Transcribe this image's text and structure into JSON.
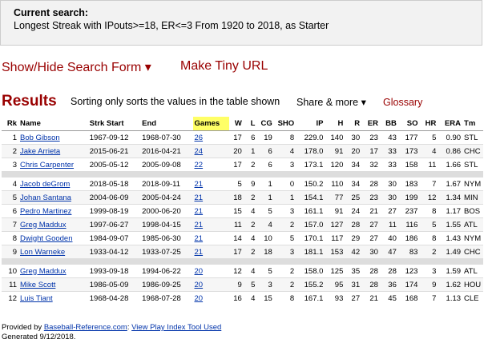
{
  "search": {
    "label": "Current search:",
    "query": "Longest Streak with IPouts>=18, ER<=3 From 1920 to 2018, as Starter"
  },
  "toggles": {
    "show_hide": "Show/Hide Search Form ▾",
    "tiny_url": "Make Tiny URL"
  },
  "results": {
    "title": "Results",
    "note": "Sorting only sorts the values in the table shown",
    "share": "Share & more ▾",
    "glossary": "Glossary"
  },
  "table": {
    "headers": [
      "Rk",
      "Name",
      "Strk Start",
      "End",
      "Games",
      "W",
      "L",
      "CG",
      "SHO",
      "IP",
      "H",
      "R",
      "ER",
      "BB",
      "SO",
      "HR",
      "ERA",
      "Tm"
    ],
    "groups": [
      [
        [
          "1",
          "Bob Gibson",
          "1967-09-12",
          "1968-07-30",
          "26",
          "17",
          "6",
          "19",
          "8",
          "229.0",
          "140",
          "30",
          "23",
          "43",
          "177",
          "5",
          "0.90",
          "STL"
        ],
        [
          "2",
          "Jake Arrieta",
          "2015-06-21",
          "2016-04-21",
          "24",
          "20",
          "1",
          "6",
          "4",
          "178.0",
          "91",
          "20",
          "17",
          "33",
          "173",
          "4",
          "0.86",
          "CHC"
        ],
        [
          "3",
          "Chris Carpenter",
          "2005-05-12",
          "2005-09-08",
          "22",
          "17",
          "2",
          "6",
          "3",
          "173.1",
          "120",
          "34",
          "32",
          "33",
          "158",
          "11",
          "1.66",
          "STL"
        ]
      ],
      [
        [
          "4",
          "Jacob deGrom",
          "2018-05-18",
          "2018-09-11",
          "21",
          "5",
          "9",
          "1",
          "0",
          "150.2",
          "110",
          "34",
          "28",
          "30",
          "183",
          "7",
          "1.67",
          "NYM"
        ],
        [
          "5",
          "Johan Santana",
          "2004-06-09",
          "2005-04-24",
          "21",
          "18",
          "2",
          "1",
          "1",
          "154.1",
          "77",
          "25",
          "23",
          "30",
          "199",
          "12",
          "1.34",
          "MIN"
        ],
        [
          "6",
          "Pedro Martinez",
          "1999-08-19",
          "2000-06-20",
          "21",
          "15",
          "4",
          "5",
          "3",
          "161.1",
          "91",
          "24",
          "21",
          "27",
          "237",
          "8",
          "1.17",
          "BOS"
        ],
        [
          "7",
          "Greg Maddux",
          "1997-06-27",
          "1998-04-15",
          "21",
          "11",
          "2",
          "4",
          "2",
          "157.0",
          "127",
          "28",
          "27",
          "11",
          "116",
          "5",
          "1.55",
          "ATL"
        ],
        [
          "8",
          "Dwight Gooden",
          "1984-09-07",
          "1985-06-30",
          "21",
          "14",
          "4",
          "10",
          "5",
          "170.1",
          "117",
          "29",
          "27",
          "40",
          "186",
          "8",
          "1.43",
          "NYM"
        ],
        [
          "9",
          "Lon Warneke",
          "1933-04-12",
          "1933-07-25",
          "21",
          "17",
          "2",
          "18",
          "3",
          "181.1",
          "153",
          "42",
          "30",
          "47",
          "83",
          "2",
          "1.49",
          "CHC"
        ]
      ],
      [
        [
          "10",
          "Greg Maddux",
          "1993-09-18",
          "1994-06-22",
          "20",
          "12",
          "4",
          "5",
          "2",
          "158.0",
          "125",
          "35",
          "28",
          "28",
          "123",
          "3",
          "1.59",
          "ATL"
        ],
        [
          "11",
          "Mike Scott",
          "1986-05-09",
          "1986-09-25",
          "20",
          "9",
          "5",
          "3",
          "2",
          "155.2",
          "95",
          "31",
          "28",
          "36",
          "174",
          "9",
          "1.62",
          "HOU"
        ],
        [
          "12",
          "Luis Tiant",
          "1968-04-28",
          "1968-07-28",
          "20",
          "16",
          "4",
          "15",
          "8",
          "167.1",
          "93",
          "27",
          "21",
          "45",
          "168",
          "7",
          "1.13",
          "CLE"
        ]
      ]
    ]
  },
  "footer": {
    "provided_by": "Provided by ",
    "site": "Baseball-Reference.com",
    "sep": ": ",
    "tool": "View Play Index Tool Used",
    "generated": "Generated 9/12/2018."
  }
}
